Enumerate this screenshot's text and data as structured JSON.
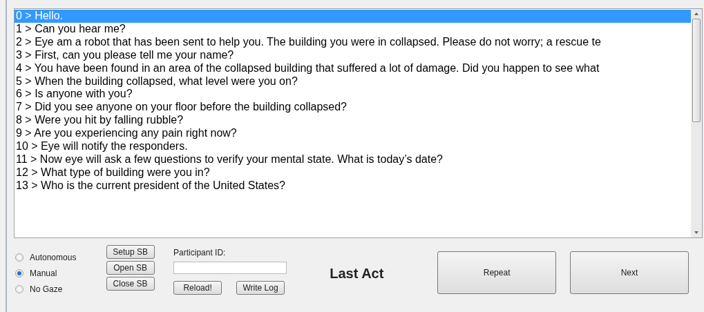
{
  "dialogue_list": {
    "rows": [
      {
        "text": "0 > Hello.",
        "selected": true
      },
      {
        "text": "1 > Can you hear me?",
        "selected": false
      },
      {
        "text": "2 > Eye am a robot that has been sent to help you. The building you were in collapsed. Please do not worry; a rescue te",
        "selected": false
      },
      {
        "text": "3 > First, can you please tell me your name?",
        "selected": false
      },
      {
        "text": "4 > You have been found in an area of the collapsed building that suffered a lot of damage. Did you happen to see what",
        "selected": false
      },
      {
        "text": "5 > When the building collapsed, what level were you on?",
        "selected": false
      },
      {
        "text": "6 > Is anyone with you?",
        "selected": false
      },
      {
        "text": "7 > Did you see anyone on your floor before the building collapsed?",
        "selected": false
      },
      {
        "text": "8 > Were you hit by falling rubble?",
        "selected": false
      },
      {
        "text": "9 > Are you experiencing any pain right now?",
        "selected": false
      },
      {
        "text": "10 > Eye will notify the responders.",
        "selected": false
      },
      {
        "text": "11 > Now eye will ask a few questions to verify your mental state. What is today’s date?",
        "selected": false
      },
      {
        "text": "12 > What type of building were you in?",
        "selected": false
      },
      {
        "text": "13 > Who is the current president of the United States?",
        "selected": false
      }
    ]
  },
  "modes": [
    {
      "label": "Autonomous",
      "selected": false
    },
    {
      "label": "Manual",
      "selected": true
    },
    {
      "label": "No Gaze",
      "selected": false
    }
  ],
  "sb_buttons": [
    "Setup SB",
    "Open SB",
    "Close SB"
  ],
  "participant_id": {
    "label": "Participant ID:"
  },
  "log_buttons": [
    "Reload!",
    "Write Log"
  ],
  "last_act": "Last Act",
  "action_buttons": [
    "Repeat",
    "Next"
  ]
}
